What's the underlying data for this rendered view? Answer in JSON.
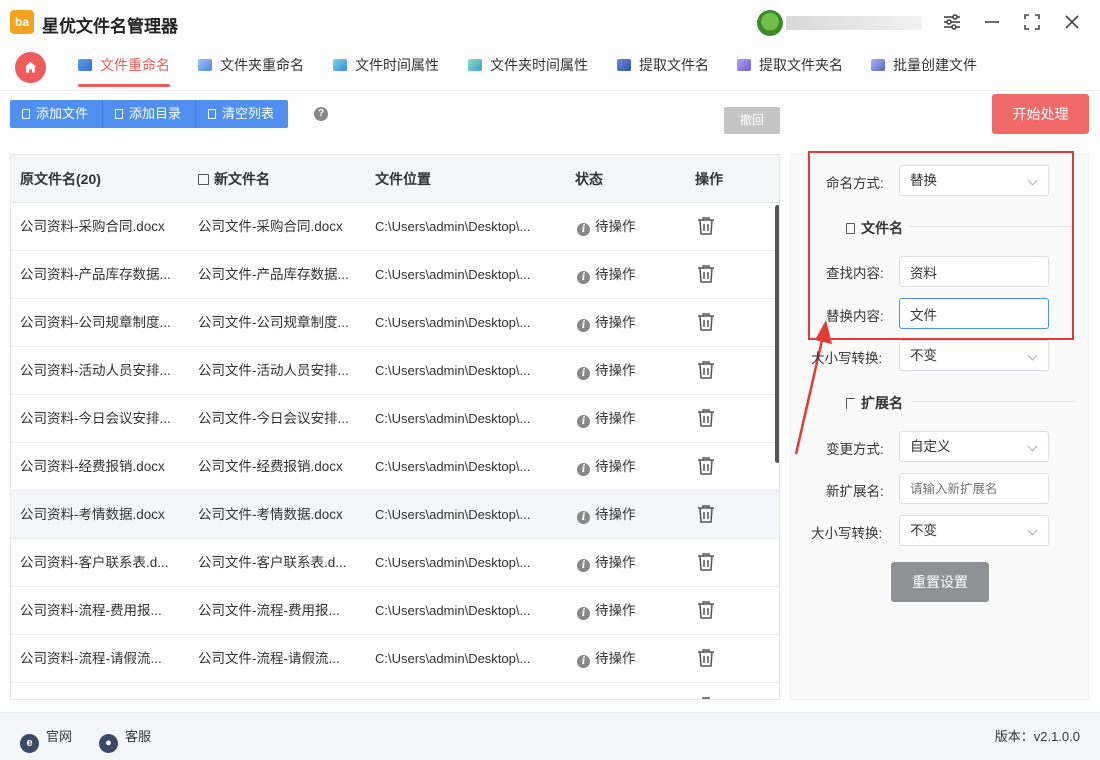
{
  "app": {
    "title": "星优文件名管理器",
    "logo_text": "ba"
  },
  "tabs": [
    {
      "label": "文件重命名",
      "icon": "file-rename-icon",
      "active": true
    },
    {
      "label": "文件夹重命名",
      "icon": "folder-rename-icon"
    },
    {
      "label": "文件时间属性",
      "icon": "file-time-icon"
    },
    {
      "label": "文件夹时间属性",
      "icon": "folder-time-icon"
    },
    {
      "label": "提取文件名",
      "icon": "extract-filename-icon"
    },
    {
      "label": "提取文件夹名",
      "icon": "extract-foldername-icon"
    },
    {
      "label": "批量创建文件",
      "icon": "batch-create-icon"
    }
  ],
  "toolbar": {
    "add_file": "添加文件",
    "add_dir": "添加目录",
    "clear_list": "清空列表",
    "help": "?",
    "undo": "撤回",
    "start": "开始处理"
  },
  "table": {
    "headers": {
      "original": "原文件名(20)",
      "new": "新文件名",
      "location": "文件位置",
      "status": "状态",
      "action": "操作"
    },
    "rows": [
      {
        "original": "公司资料-采购合同.docx",
        "new": "公司文件-采购合同.docx",
        "location": "C:\\Users\\admin\\Desktop\\...",
        "status": "待操作"
      },
      {
        "original": "公司资料-产品库存数据...",
        "new": "公司文件-产品库存数据...",
        "location": "C:\\Users\\admin\\Desktop\\...",
        "status": "待操作"
      },
      {
        "original": "公司资料-公司规章制度...",
        "new": "公司文件-公司规章制度...",
        "location": "C:\\Users\\admin\\Desktop\\...",
        "status": "待操作"
      },
      {
        "original": "公司资料-活动人员安排...",
        "new": "公司文件-活动人员安排...",
        "location": "C:\\Users\\admin\\Desktop\\...",
        "status": "待操作"
      },
      {
        "original": "公司资料-今日会议安排...",
        "new": "公司文件-今日会议安排...",
        "location": "C:\\Users\\admin\\Desktop\\...",
        "status": "待操作"
      },
      {
        "original": "公司资料-经费报销.docx",
        "new": "公司文件-经费报销.docx",
        "location": "C:\\Users\\admin\\Desktop\\...",
        "status": "待操作"
      },
      {
        "original": "公司资料-考情数据.docx",
        "new": "公司文件-考情数据.docx",
        "location": "C:\\Users\\admin\\Desktop\\...",
        "status": "待操作"
      },
      {
        "original": "公司资料-客户联系表.d...",
        "new": "公司文件-客户联系表.d...",
        "location": "C:\\Users\\admin\\Desktop\\...",
        "status": "待操作"
      },
      {
        "original": "公司资料-流程-费用报...",
        "new": "公司文件-流程-费用报...",
        "location": "C:\\Users\\admin\\Desktop\\...",
        "status": "待操作"
      },
      {
        "original": "公司资料-流程-请假流...",
        "new": "公司文件-流程-请假流...",
        "location": "C:\\Users\\admin\\Desktop\\...",
        "status": "待操作"
      }
    ]
  },
  "settings": {
    "naming_mode_label": "命名方式:",
    "naming_mode_value": "替换",
    "filename_section": "文件名",
    "find_label": "查找内容:",
    "find_value": "资料",
    "replace_label": "替换内容:",
    "replace_value": "文件",
    "case_label": "大小写转换:",
    "case_value": "不变",
    "ext_section": "扩展名",
    "ext_mode_label": "变更方式:",
    "ext_mode_value": "自定义",
    "new_ext_label": "新扩展名:",
    "new_ext_placeholder": "请输入新扩展名",
    "ext_case_label": "大小写转换:",
    "ext_case_value": "不变",
    "reset": "重置设置"
  },
  "footer": {
    "website": "官网",
    "support": "客服",
    "version": "版本：v2.1.0.0"
  },
  "colors": {
    "accent": "#ef5a5a",
    "primary": "#4f8ff0",
    "highlight": "#e53935"
  }
}
